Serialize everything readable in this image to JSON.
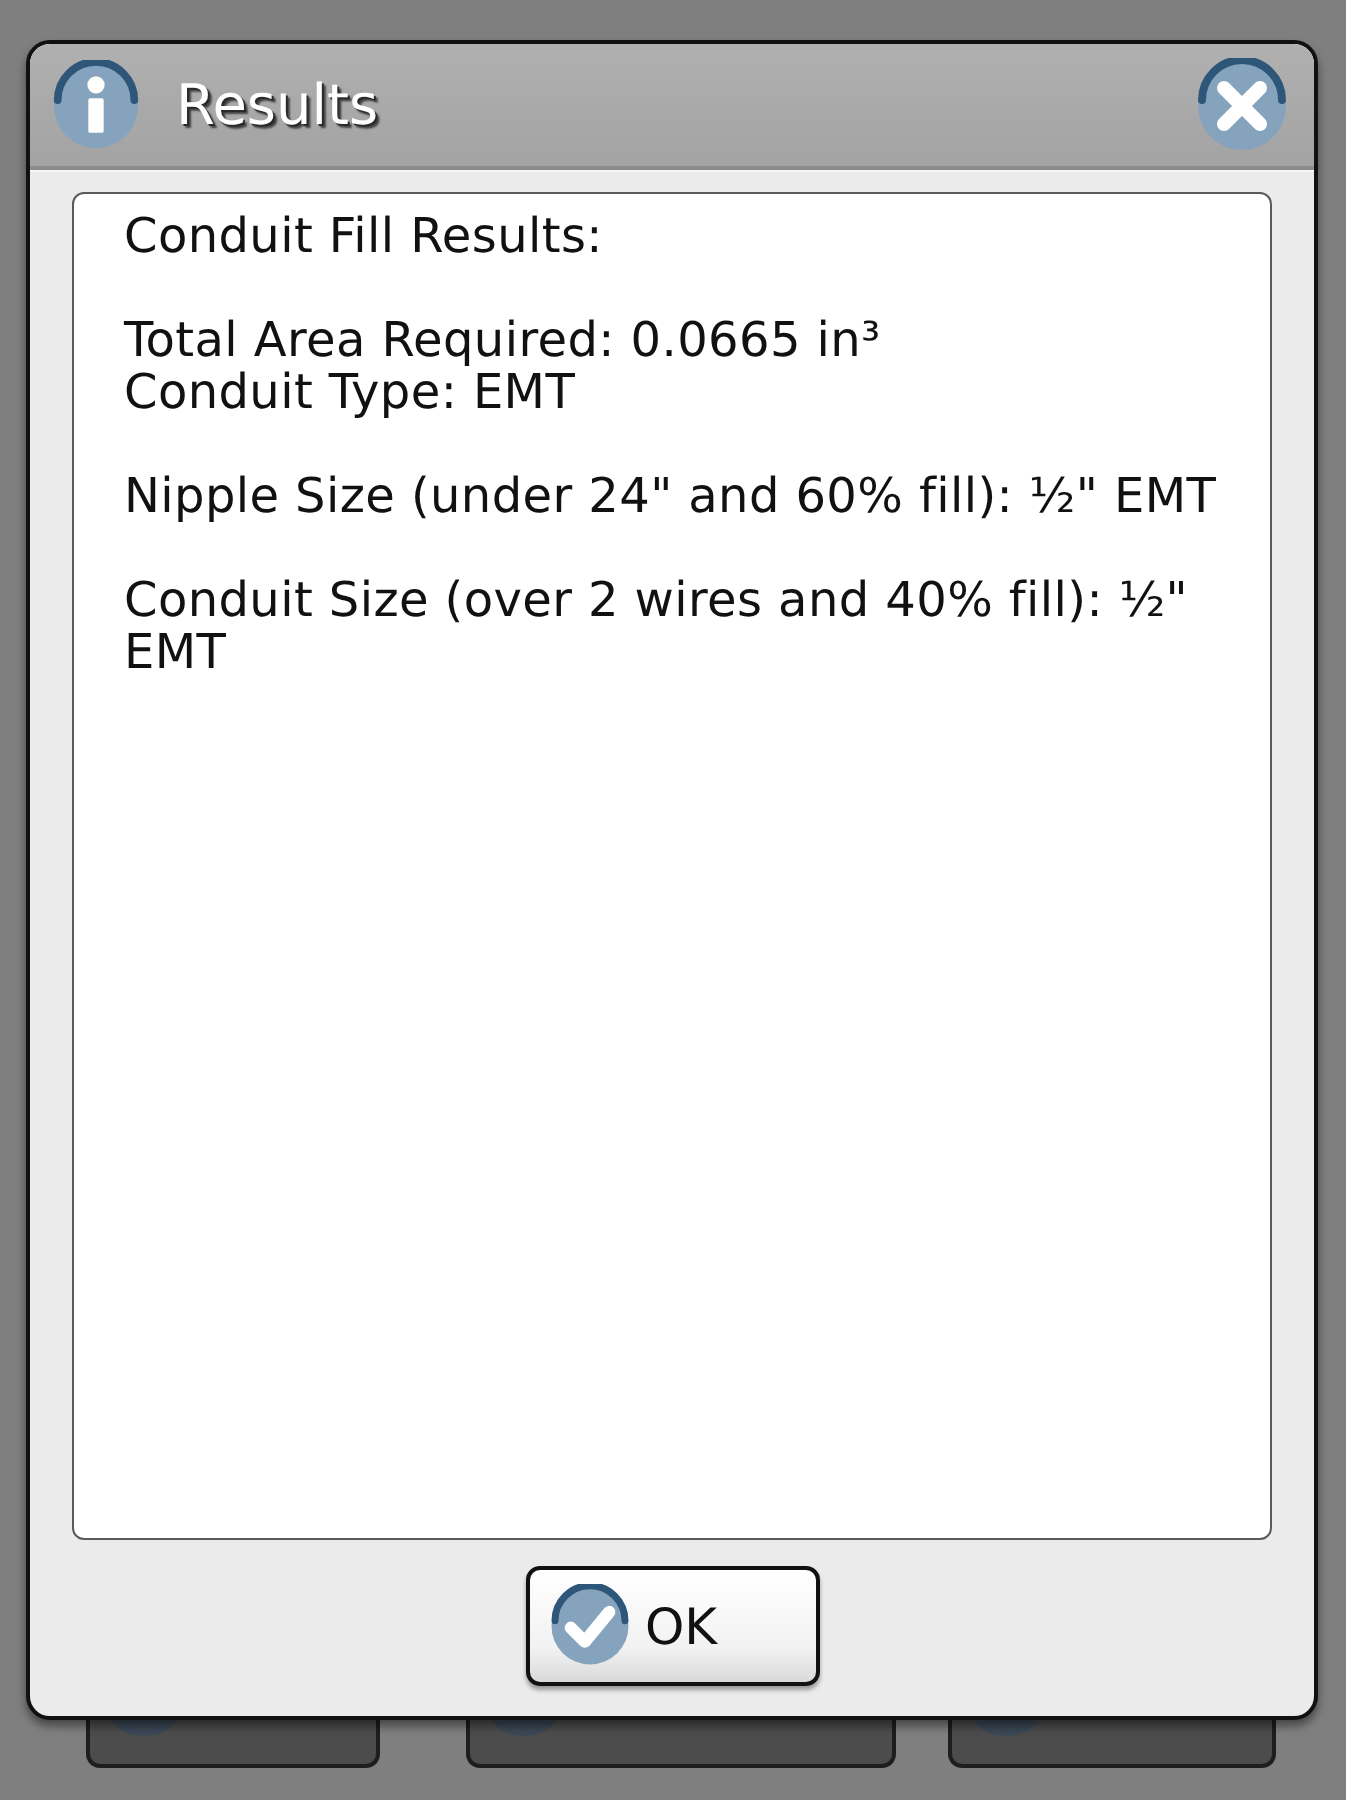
{
  "background": {
    "dimmed": true,
    "buttons": [
      {
        "kind": "icon_button"
      },
      {
        "kind": "icon_button"
      },
      {
        "kind": "icon_button"
      }
    ]
  },
  "dialog": {
    "title": "Results",
    "paragraphs": [
      {
        "lines": [
          "Conduit Fill Results:"
        ]
      },
      {
        "lines": [
          "Total Area Required: 0.0665 in³",
          "Conduit Type: EMT"
        ]
      },
      {
        "lines": [
          "Nipple Size (under 24\" and 60% fill): ½\" EMT"
        ]
      },
      {
        "lines": [
          "Conduit Size (over 2 wires and 40% fill): ½\" EMT"
        ]
      }
    ],
    "buttons": [
      {
        "label": "OK"
      }
    ]
  }
}
